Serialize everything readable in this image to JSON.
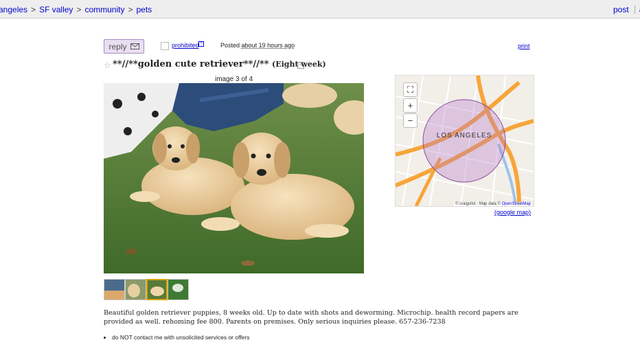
{
  "breadcrumbs": [
    "angeles",
    "SF valley",
    "community",
    "pets"
  ],
  "top_links": {
    "post": "post",
    "account": "ac"
  },
  "actions": {
    "reply_label": "reply",
    "prohibited_label": "prohibited",
    "help_label": "?",
    "posted_prefix": "Posted",
    "posted_time": "about 19 hours ago",
    "print_label": "print"
  },
  "listing": {
    "title": "**//**golden cute retriever**//**",
    "title_tag": "(Eight week)"
  },
  "gallery": {
    "counter": "image 3 of 4",
    "thumbnails": 4,
    "selected": 3
  },
  "map": {
    "city_label": "LOS ANGELES",
    "attribution_prefix": "© craigslist - Map data ©",
    "attribution_osm": "OpenStreetMap",
    "link_label": "(google map)"
  },
  "description": "Beautiful golden retriever puppies, 8 weeks old. Up to date with shots and deworming. Microchip. health record papers are provided as well. rehoming fee 800. Parents on premises. Only serious inquiries please. 657-236-7238",
  "notices": [
    "do NOT contact me with unsolicited services or offers"
  ],
  "colors": {
    "link": "#0000cc",
    "reply_bg": "#eadff2",
    "thumb_selected": "#d9a400"
  }
}
